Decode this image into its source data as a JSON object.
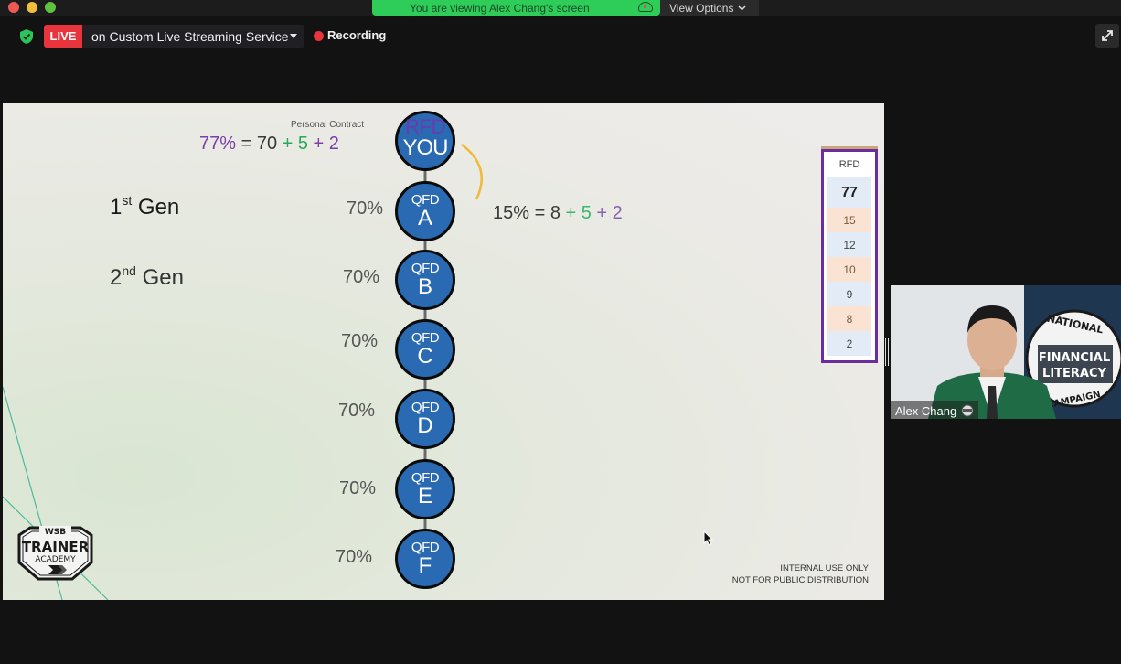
{
  "window": {
    "share_banner": "You are viewing Alex Chang's screen",
    "view_options_label": "View Options"
  },
  "status_bar": {
    "live_badge": "LIVE",
    "stream_target": "on Custom Live Streaming Service",
    "recording_label": "Recording"
  },
  "slide": {
    "personal_contract_label": "Personal Contract",
    "you_equation": {
      "total": "77%",
      "eq": " = 70 ",
      "plus5": "+ 5",
      "plus2": " + 2"
    },
    "a_equation": {
      "total": "15% = 8 ",
      "plus5": "+ 5",
      "plus2": " + 2"
    },
    "gen_labels": [
      {
        "num": "1",
        "suffix": "st",
        "word": " Gen"
      },
      {
        "num": "2",
        "suffix": "nd",
        "word": " Gen"
      }
    ],
    "top_node": {
      "top": "RFD",
      "bottom": "YOU"
    },
    "nodes": [
      {
        "top": "QFD",
        "bottom": "A",
        "pct": "70%"
      },
      {
        "top": "QFD",
        "bottom": "B",
        "pct": "70%"
      },
      {
        "top": "QFD",
        "bottom": "C",
        "pct": "70%"
      },
      {
        "top": "QFD",
        "bottom": "D",
        "pct": "70%"
      },
      {
        "top": "QFD",
        "bottom": "E",
        "pct": "70%"
      },
      {
        "top": "QFD",
        "bottom": "F",
        "pct": "70%"
      }
    ],
    "rfd_table": {
      "header": "RFD",
      "total": "77",
      "values": [
        "15",
        "12",
        "10",
        "9",
        "8",
        "2"
      ]
    },
    "disclaimer": [
      "INTERNAL USE ONLY",
      "NOT FOR PUBLIC DISTRIBUTION"
    ],
    "logo": {
      "line1": "WSB",
      "line2": "TRAINER",
      "line3": "ACADEMY"
    }
  },
  "participant": {
    "name": "Alex Chang",
    "banner": {
      "line1": "NATIONAL",
      "line2": "FINANCIAL",
      "line3": "LITERACY",
      "line4": "CAMPAIGN"
    }
  },
  "colors": {
    "live_red": "#e8343c",
    "share_green": "#2ecc59",
    "node_blue": "#2a6ab2",
    "rfd_purple": "#6b2d9e",
    "accent_green": "#2aa85a",
    "connector_yellow": "#f0b93a"
  }
}
